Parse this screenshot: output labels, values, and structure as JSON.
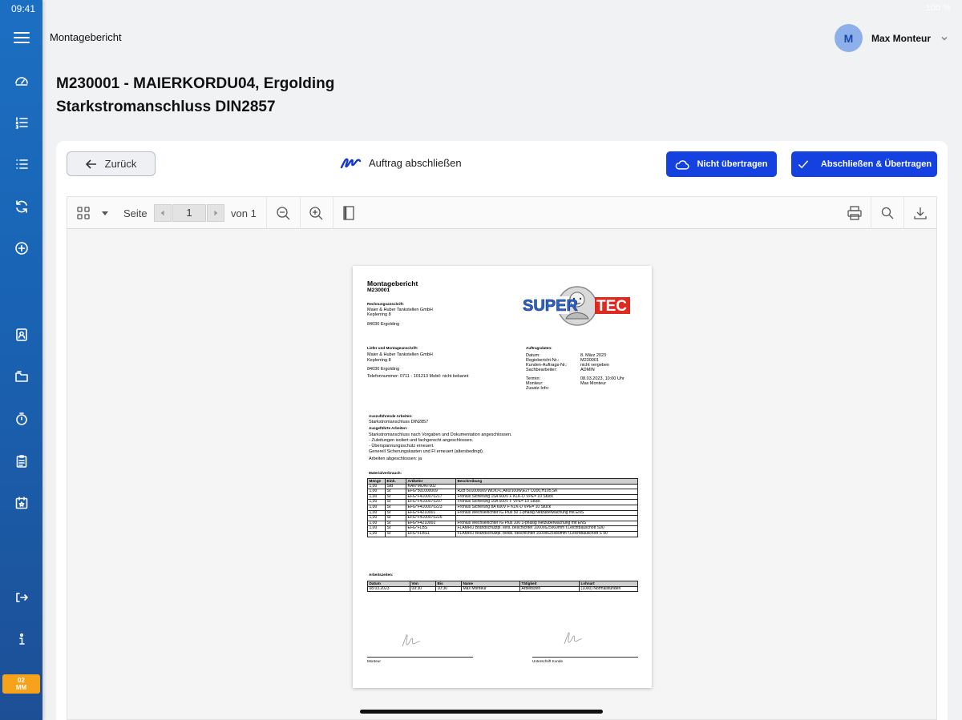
{
  "status_bar": {
    "time": "09:41",
    "battery": "100 %"
  },
  "sidebar": {
    "items": [
      {
        "icon": "menu-icon"
      },
      {
        "icon": "dashboard-icon"
      },
      {
        "icon": "ordered-list-icon"
      },
      {
        "icon": "list-icon"
      },
      {
        "icon": "sync-icon"
      },
      {
        "icon": "add-circle-icon"
      },
      {
        "icon": "contacts-icon"
      },
      {
        "icon": "folder-icon"
      },
      {
        "icon": "timer-icon"
      },
      {
        "icon": "clipboard-icon"
      },
      {
        "icon": "calendar-icon"
      },
      {
        "icon": "logout-icon"
      },
      {
        "icon": "info-icon"
      }
    ],
    "badge_line1": "02",
    "badge_line2": "MM"
  },
  "header": {
    "title": "Montagebericht",
    "user_initial": "M",
    "user_name": "Max Monteur"
  },
  "page": {
    "title_line1": "M230001 - MAIERKORDU04, Ergolding",
    "title_line2": "Starkstromanschluss DIN2857"
  },
  "actions": {
    "back_label": "Zurück",
    "center_title": "Auftrag abschließen",
    "nicht_label": "Nicht übertragen",
    "abschl_label": "Abschließen & Übertragen"
  },
  "viewer": {
    "page_label": "Seite",
    "page_value": "1",
    "of_label": "von 1"
  },
  "document": {
    "title": "Montagebericht",
    "number": "M230001",
    "logo_text_left": "SUPER",
    "logo_text_right": "TEC",
    "billing_heading": "Rechnungsanschrift:",
    "billing_lines": [
      "Maier & Huber Tankstellen GmbH",
      "Keplerring 8",
      "84030 Ergolding"
    ],
    "delivery_heading": "Liefer und Montageanschrift:",
    "delivery_lines": [
      "Maier & Huber Tankstellen GmbH",
      "Keplerring 8",
      "84030 Ergolding",
      "Telefonnummer: 0711 - 101213 Mobil: nicht bekannt"
    ],
    "order_heading": "Auftragsdaten:",
    "order_labels": [
      "Datum:",
      "Regiebericht-Nr.:",
      "Kunden-Auftrags-Nr.:",
      "Sachbearbeiter:",
      "Termin:",
      "Monteur:",
      "Zusatz-Info:"
    ],
    "order_values": [
      "8. März 2023",
      "M230001",
      "nicht vergeben",
      "ADMIN",
      "08.03.2023, 10:00 Uhr",
      "Max Monteur",
      ""
    ],
    "work_heading": "Auszuführende Arbeiten:",
    "work_text": "Starkstromanschluss DIN2857",
    "done_heading": "Ausgeführte Arbeiten:",
    "done_lines": [
      "Starkstromanschluss nach Vorgaben und Dokumentation angeschlossen.",
      "- Zuleitungen isoliert und fachgerecht angeschlossen.",
      "- Überspannungsschutz erneuert.",
      "Generell Sicherungskasten und FI erneuert (altersbedingt).",
      "Arbeiten abgeschlossen: ja"
    ],
    "material_heading": "Materialverbrauch:",
    "material_columns": [
      "Menge",
      "Einh.",
      "Artikelnr",
      "Beschreibung"
    ],
    "material_rows": [
      [
        "1,00",
        "Std",
        "KAN*MONT002",
        ""
      ],
      [
        "1,00",
        "St",
        "EFG*501000009",
        "RZB 501000009 WD/D-L,A60/100W,E27 D200,H105,SK"
      ],
      [
        "1,00",
        "St",
        "EFG*F4100070217",
        "Fronius Sicherung 15A 600V F KLK-D                    VPE= 10 Stück"
      ],
      [
        "1,00",
        "St",
        "EFG*F4100070207",
        "Fronius Sicherung 10A 600V F                            VPE= 10 Stück"
      ],
      [
        "1,00",
        "St",
        "EFG*F4100070223",
        "Fronius Sicherung 8A 600V F KLK-D                      VPE= 10 Stück"
      ],
      [
        "1,00",
        "St",
        "EFG*F4210001",
        "Fronius Wechselrichter IG Plus 50 1-phasig Netzüberwachung mit ENS"
      ],
      [
        "1,00",
        "St",
        "EFG*F4100070226",
        ""
      ],
      [
        "1,00",
        "St",
        "EFG*F4210002",
        "Fronius Wechselrichter IG Plus 100 1-phasig Netzüberwachung mit ENS"
      ],
      [
        "1,00",
        "St",
        "EFG*FLBS",
        "FLAMRO Brandschutzpl. eins. beschichtet 1000x625x60mm f.Leichtbauschott S90"
      ],
      [
        "1,00",
        "St",
        "EFG*FLBS1",
        "FLAMRO Brandschutzpl. beids. beschichtet 1000x625x80mm f.Leichtbauschott S 90"
      ]
    ],
    "time_heading": "Arbeitszeiten:",
    "time_columns": [
      "Datum",
      "Von",
      "Bis",
      "Name",
      "Tätigkeit",
      "Lohnart"
    ],
    "time_rows": [
      [
        "08.03.2023",
        "09:30",
        "10:30",
        "Max Monteur",
        "Arbeitszeit",
        "(1000) Normalstunden"
      ]
    ],
    "sig_left_label": "Monteur",
    "sig_right_label": "Unterschrift Kunde"
  },
  "colors": {
    "sidebar": "#1b6fc3",
    "primary_button": "#1441e0",
    "badge": "#f7a21b",
    "avatar": "#8db0ea"
  }
}
